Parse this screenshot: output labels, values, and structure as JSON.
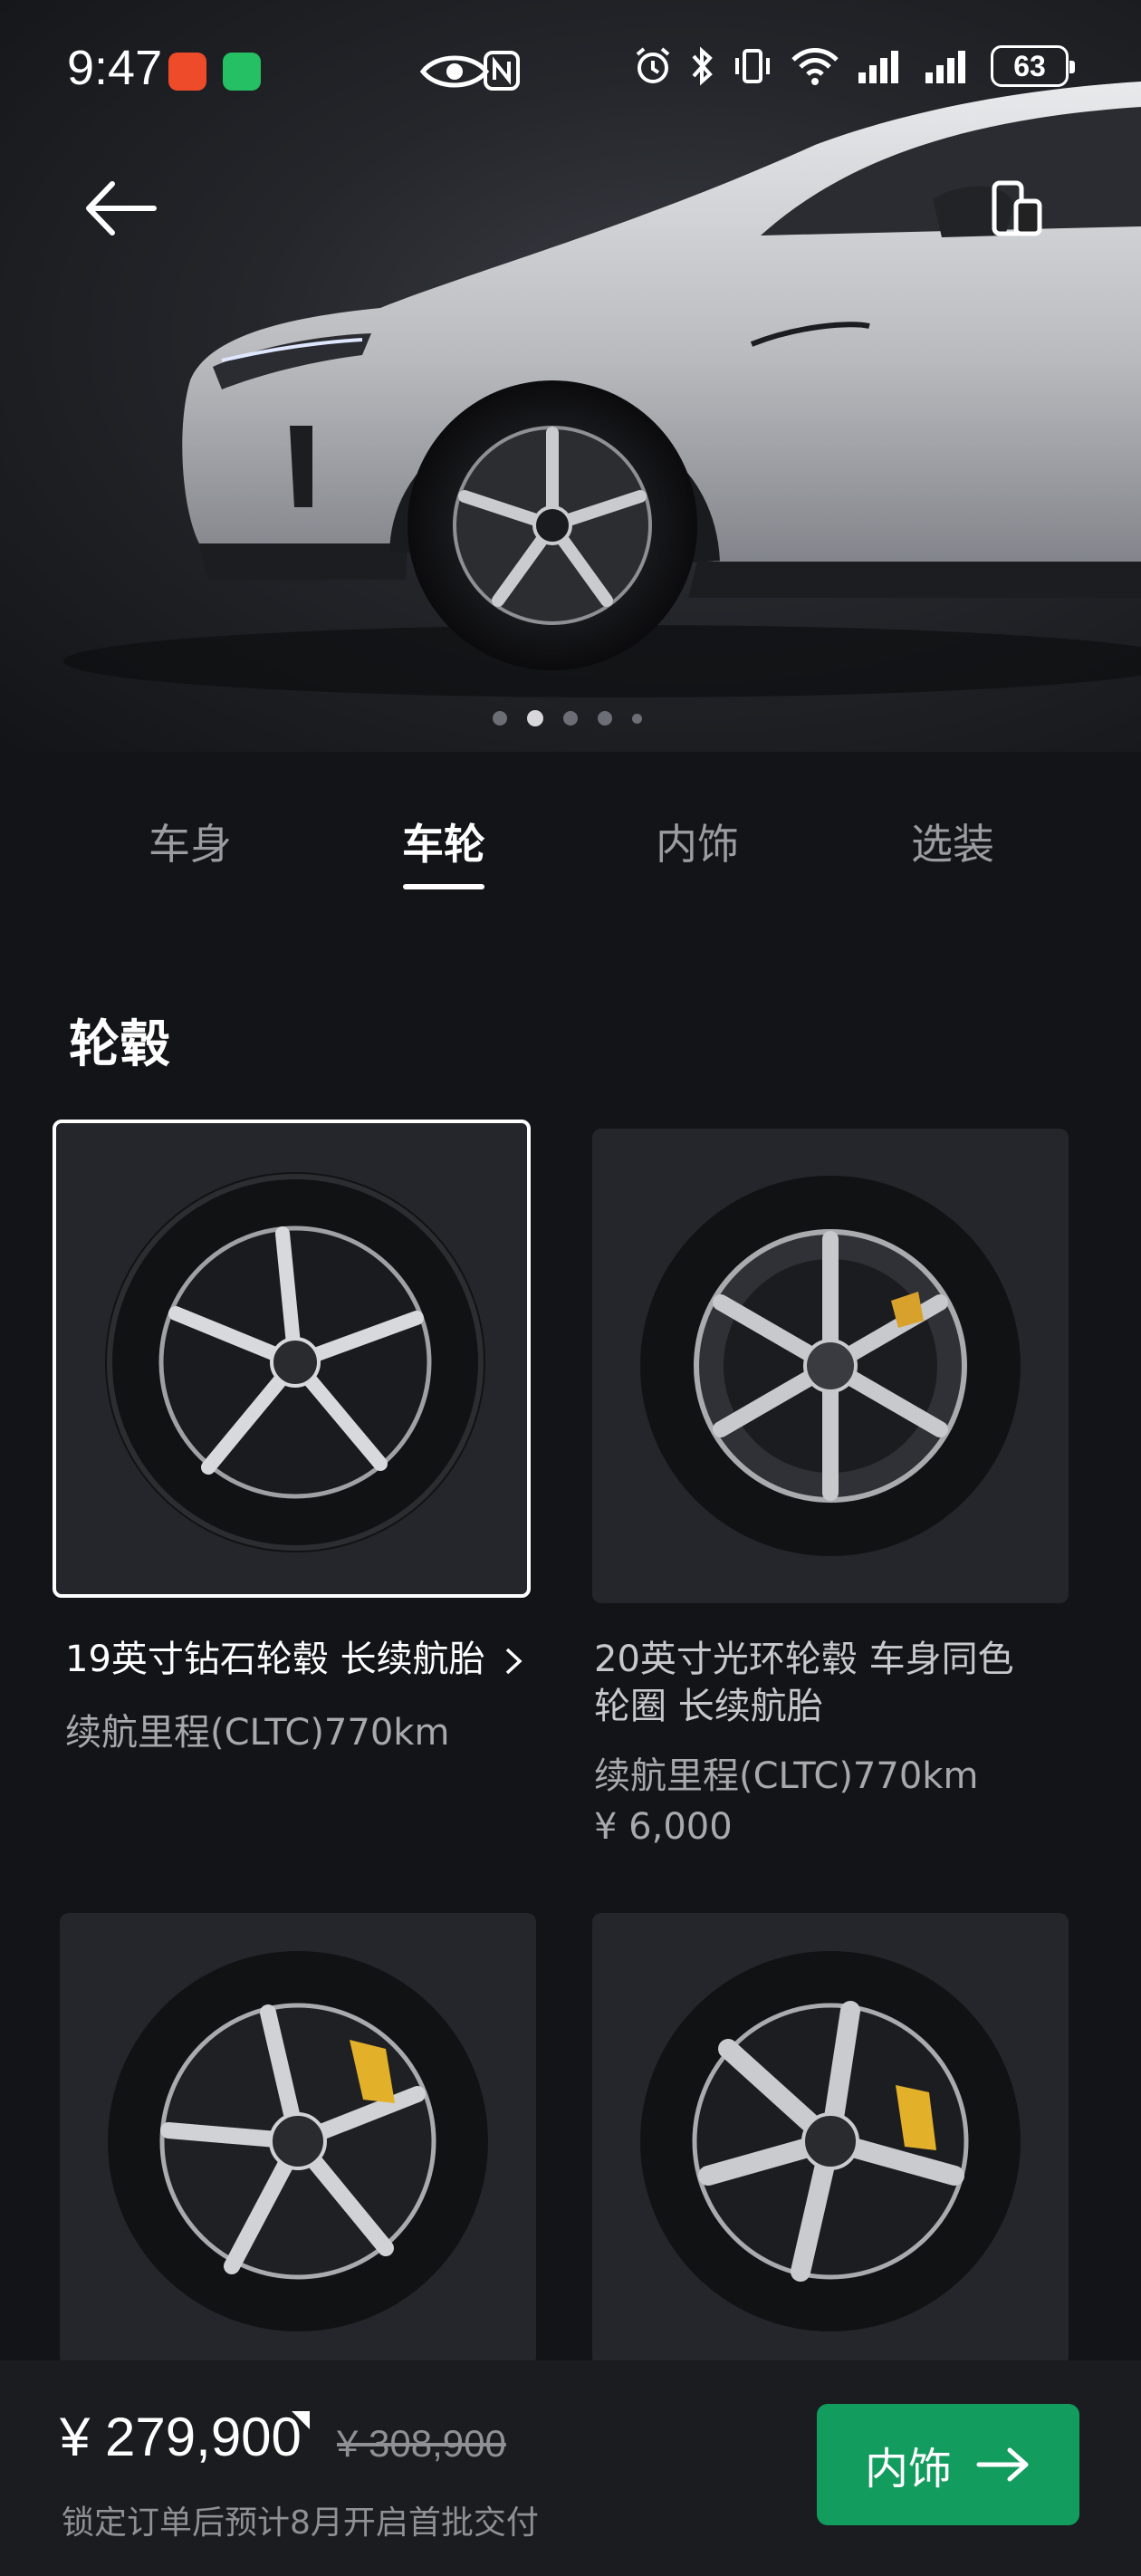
{
  "status_bar": {
    "time": "9:47",
    "battery": "63",
    "app_icons": [
      "stocks-app-icon",
      "wechat-app-icon"
    ],
    "right_icons": [
      "eye-icon",
      "nfc-icon",
      "alarm-icon",
      "bluetooth-icon",
      "vibrate-icon",
      "wifi-icon",
      "signal-icon",
      "signal-icon"
    ]
  },
  "header": {
    "back_icon": "arrow-left-icon",
    "device_icon": "phone-tablet-icon",
    "carousel": {
      "count": 5,
      "active_index": 1
    }
  },
  "tabs": [
    {
      "label": "车身",
      "active": false
    },
    {
      "label": "车轮",
      "active": true
    },
    {
      "label": "内饰",
      "active": false
    },
    {
      "label": "选装",
      "active": false
    }
  ],
  "section": {
    "title": "轮毂",
    "options": [
      {
        "title": "19英寸钻石轮毂 长续航胎",
        "chevron": "chevron-right-icon",
        "range": "续航里程(CLTC)770km",
        "price": "",
        "selected": true
      },
      {
        "title_line1": "20英寸光环轮毂 车身同色",
        "title_line2": "轮圈 长续航胎",
        "range": "续航里程(CLTC)770km",
        "price": "¥ 6,000",
        "selected": false
      },
      {
        "selected": false
      },
      {
        "selected": false
      }
    ]
  },
  "bottom_bar": {
    "price": "¥ 279,900",
    "old_price": "¥ 308,900",
    "delivery_note": "锁定订单后预计8月开启首批交付",
    "next_button": "内饰",
    "next_icon": "arrow-right-icon",
    "accent_color": "#129c5e"
  }
}
